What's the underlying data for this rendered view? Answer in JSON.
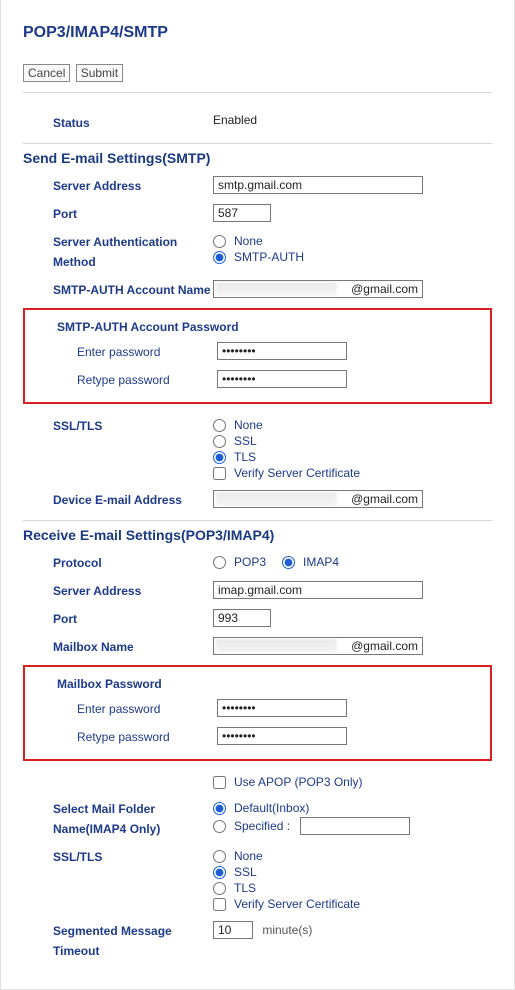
{
  "title": "POP3/IMAP4/SMTP",
  "buttons": {
    "cancel": "Cancel",
    "submit": "Submit"
  },
  "status": {
    "label": "Status",
    "value": "Enabled"
  },
  "send": {
    "heading": "Send E-mail Settings(SMTP)",
    "serverAddressLabel": "Server Address",
    "serverAddress": "smtp.gmail.com",
    "portLabel": "Port",
    "port": "587",
    "authMethodLabel": "Server Authentication Method",
    "authOptions": {
      "none": "None",
      "smtpAuth": "SMTP-AUTH"
    },
    "authSelected": "smtpAuth",
    "accountNameLabel": "SMTP-AUTH Account Name",
    "accountNameSuffix": "@gmail.com",
    "passwordGroup": "SMTP-AUTH Account Password",
    "enterPasswordLabel": "Enter password",
    "enterPassword": "••••••••",
    "retypePasswordLabel": "Retype password",
    "retypePassword": "••••••••",
    "sslLabel": "SSL/TLS",
    "sslOptions": {
      "none": "None",
      "ssl": "SSL",
      "tls": "TLS"
    },
    "sslSelected": "tls",
    "verifyCertLabel": "Verify Server Certificate",
    "verifyCert": false,
    "deviceEmailLabel": "Device E-mail Address",
    "deviceEmailSuffix": "@gmail.com"
  },
  "receive": {
    "heading": "Receive E-mail Settings(POP3/IMAP4)",
    "protocolLabel": "Protocol",
    "protoOptions": {
      "pop3": "POP3",
      "imap4": "IMAP4"
    },
    "protoSelected": "imap4",
    "serverAddressLabel": "Server Address",
    "serverAddress": "imap.gmail.com",
    "portLabel": "Port",
    "port": "993",
    "mailboxNameLabel": "Mailbox Name",
    "mailboxNameSuffix": "@gmail.com",
    "passwordGroup": "Mailbox Password",
    "enterPasswordLabel": "Enter password",
    "enterPassword": "••••••••",
    "retypePasswordLabel": "Retype password",
    "retypePassword": "••••••••",
    "useApopLabel": "Use APOP (POP3 Only)",
    "useApop": false,
    "folderLabel": "Select Mail Folder Name(IMAP4 Only)",
    "folderOptions": {
      "default": "Default(Inbox)",
      "specified": "Specified :"
    },
    "folderSelected": "default",
    "folderSpecifiedValue": "",
    "sslLabel": "SSL/TLS",
    "sslOptions": {
      "none": "None",
      "ssl": "SSL",
      "tls": "TLS"
    },
    "sslSelected": "ssl",
    "verifyCertLabel": "Verify Server Certificate",
    "verifyCert": false,
    "timeoutLabel": "Segmented Message Timeout",
    "timeoutValue": "10",
    "timeoutUnit": "minute(s)"
  }
}
